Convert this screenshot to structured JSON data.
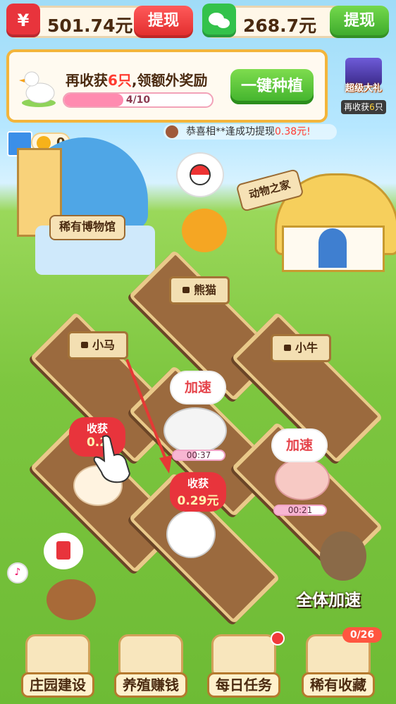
{
  "wallet_red": {
    "amount": "501.74元",
    "button": "提现",
    "logo": "¥"
  },
  "wallet_wechat": {
    "amount": "268.7元",
    "button": "提现"
  },
  "reward": {
    "title_prefix": "再收获",
    "title_highlight": "6只",
    "title_suffix": ",领额外奖励",
    "progress_text": "4/10",
    "progress_value": 0.4,
    "plant_button": "一键种植"
  },
  "gift": {
    "title": "超级大礼",
    "sub_prefix": "再收获",
    "sub_highlight": "6",
    "sub_suffix": "只"
  },
  "coins": {
    "value": "0"
  },
  "ticker": {
    "prefix": "恭喜相**逢成功提现",
    "amount": "0.38元!"
  },
  "buildings": {
    "museum": "稀有博物馆",
    "animal_home": "动物之家"
  },
  "plots": {
    "panda": {
      "label": "熊猫"
    },
    "horse": {
      "label": "小马"
    },
    "cow": {
      "label": "小牛"
    }
  },
  "speedup_label": "加速",
  "sheep_timer": {
    "text": "00:37",
    "progress": 0.45
  },
  "pig_timer": {
    "text": "00:21",
    "progress": 0.65
  },
  "harvest_left": {
    "title": "收获",
    "amount": "0.2"
  },
  "harvest_right": {
    "title": "收获",
    "amount": "0.29元"
  },
  "accel_all": "全体加速",
  "nav": [
    {
      "label": "庄园建设"
    },
    {
      "label": "养殖赚钱"
    },
    {
      "label": "每日任务"
    },
    {
      "label": "稀有收藏"
    }
  ],
  "collection_badge": "0/26",
  "colors": {
    "red": "#e8343c",
    "green": "#3fb12b",
    "gold": "#f3b53b"
  }
}
